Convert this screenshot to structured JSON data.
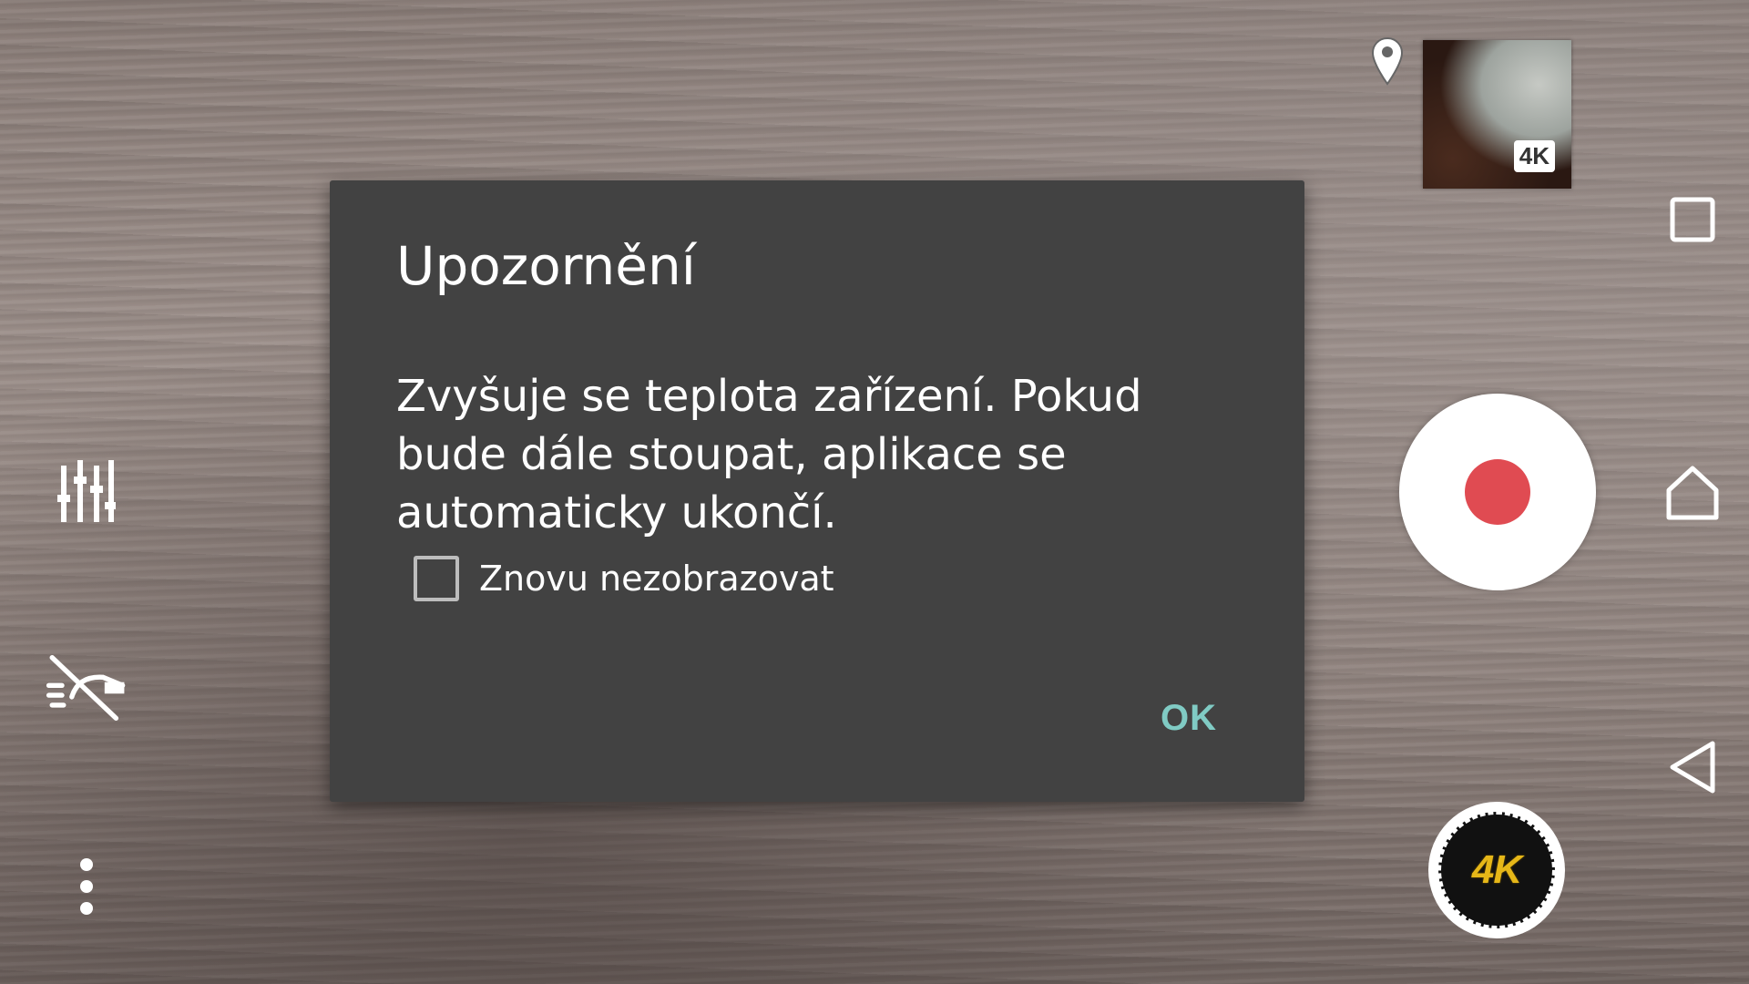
{
  "dialog": {
    "title": "Upozornění",
    "message": "Zvyšuje se teplota zařízení. Pokud bude dále stoupat, aplikace se automaticky ukončí.",
    "checkbox_label": "Znovu nezobrazovat",
    "checkbox_checked": false,
    "ok_label": "OK",
    "accent_color": "#80cbc4",
    "background_color": "#424242"
  },
  "camera": {
    "thumbnail_badge": "4K",
    "mode_button_label": "4K",
    "record_color": "#e04b52",
    "mode_label_color": "#e6b718"
  },
  "left_toolbar": {
    "icons": [
      "settings-sliders-icon",
      "flash-off-icon",
      "more-options-icon"
    ]
  },
  "navigation_bar": {
    "icons": [
      "recents-square-icon",
      "home-icon",
      "back-triangle-icon"
    ]
  }
}
